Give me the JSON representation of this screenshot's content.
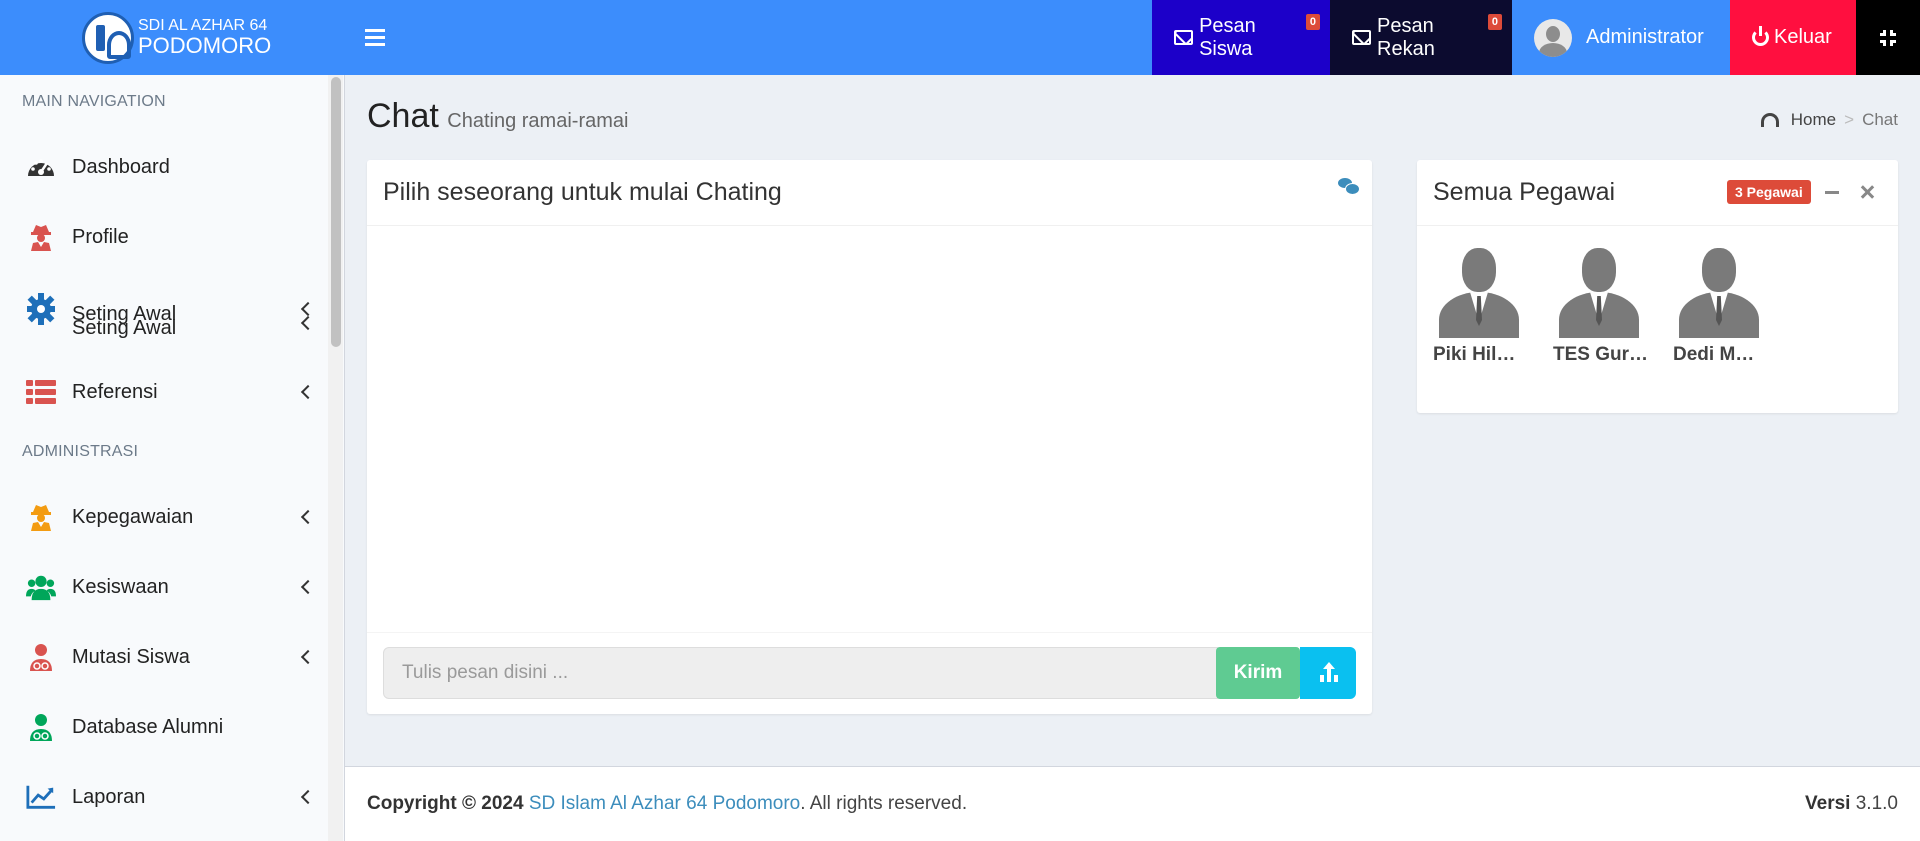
{
  "brand": {
    "line1": "SDI AL AZHAR 64",
    "line2": "PODOMORO"
  },
  "topnav": {
    "pesan_siswa": "Pesan Siswa",
    "pesan_siswa_count": "0",
    "pesan_rekan": "Pesan Rekan",
    "pesan_rekan_count": "0",
    "user": "Administrator",
    "logout": "Keluar"
  },
  "sidebar": {
    "header_main": "MAIN NAVIGATION",
    "header_admin": "ADMINISTRASI",
    "items": [
      {
        "label": "Dashboard",
        "icon": "dashboard-icon"
      },
      {
        "label": "Profile",
        "icon": "user-secret-icon"
      },
      {
        "label": "Seting Awal",
        "icon": "gear-icon"
      },
      {
        "label": "Seting Awal",
        "icon": "gear-icon"
      },
      {
        "label": "Referensi",
        "icon": "list-icon"
      },
      {
        "label": "Kepegawaian",
        "icon": "user-secret-icon"
      },
      {
        "label": "Kesiswaan",
        "icon": "users-icon"
      },
      {
        "label": "Mutasi Siswa",
        "icon": "user-md-icon"
      },
      {
        "label": "Database Alumni",
        "icon": "user-md-icon"
      },
      {
        "label": "Laporan",
        "icon": "line-chart-icon"
      }
    ]
  },
  "page": {
    "title": "Chat",
    "subtitle": "Chating ramai-ramai"
  },
  "breadcrumb": {
    "home": "Home",
    "current": "Chat"
  },
  "chat": {
    "title": "Pilih seseorang untuk mulai Chating",
    "input_placeholder": "Tulis pesan disini ...",
    "send_label": "Kirim"
  },
  "pegawai": {
    "title": "Semua Pegawai",
    "badge": "3 Pegawai",
    "members": [
      {
        "name": "Piki Hil…"
      },
      {
        "name": "TES Gur…"
      },
      {
        "name": "Dedi M…"
      }
    ]
  },
  "footer": {
    "copyright": "Copyright © 2024",
    "school": "SD Islam Al Azhar 64 Podomoro",
    "rights": ". All rights reserved.",
    "version_label": "Versi",
    "version": "3.1.0"
  },
  "colors": {
    "header": "#3c8dfc",
    "pesan_siswa": "#1c00c9",
    "pesan_rekan": "#0c0b2f",
    "keluar": "#ff0f3f",
    "kirim": "#5fcb92",
    "upload": "#0ac0f0",
    "badge": "#dd4b39"
  }
}
